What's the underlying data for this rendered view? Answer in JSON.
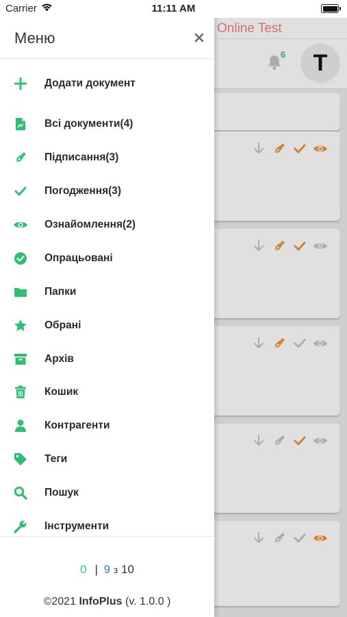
{
  "status_bar": {
    "carrier": "Carrier",
    "time": "11:11 AM"
  },
  "background": {
    "app_title": "Online Test",
    "notifications_count": "6",
    "avatar_letter": "T",
    "cards": [
      {
        "download": "grey",
        "sign": "orange",
        "approve": "orange",
        "view": "orange"
      },
      {
        "download": "grey",
        "sign": "orange",
        "approve": "orange",
        "view": "grey"
      },
      {
        "download": "grey",
        "sign": "orange",
        "approve": "grey",
        "view": "grey"
      },
      {
        "download": "grey",
        "sign": "grey",
        "approve": "orange",
        "view": "grey"
      },
      {
        "download": "grey",
        "sign": "grey",
        "approve": "grey",
        "view": "orange"
      }
    ]
  },
  "drawer": {
    "title": "Меню",
    "items": [
      {
        "label": "Додати документ",
        "icon": "plus-icon"
      },
      {
        "label": "Всі документи(4)",
        "icon": "document-icon"
      },
      {
        "label": "Підписання(3)",
        "icon": "pen-icon"
      },
      {
        "label": "Погодження(3)",
        "icon": "check-icon"
      },
      {
        "label": "Ознайомлення(2)",
        "icon": "eye-icon"
      },
      {
        "label": "Опрацьовані",
        "icon": "check-circle-icon"
      },
      {
        "label": "Папки",
        "icon": "folder-icon"
      },
      {
        "label": "Обрані",
        "icon": "star-icon"
      },
      {
        "label": "Архів",
        "icon": "archive-icon"
      },
      {
        "label": "Кошик",
        "icon": "trash-icon"
      },
      {
        "label": "Контрагенти",
        "icon": "user-icon"
      },
      {
        "label": "Теги",
        "icon": "tag-icon"
      },
      {
        "label": "Пошук",
        "icon": "search-icon"
      },
      {
        "label": "Інструменти",
        "icon": "wrench-icon"
      }
    ],
    "footer": {
      "pager_current": "0",
      "pager_separator": "|",
      "pager_page": "9",
      "pager_of": "з",
      "pager_total": "10",
      "copyright_prefix": "©2021",
      "copyright_brand": "InfoPlus",
      "copyright_version": "(v. 1.0.0 )"
    }
  },
  "colors": {
    "accent_green": "#2fbf71",
    "orange": "#f0953a",
    "grey_icon": "#c4c4c4",
    "title_red": "#f08080"
  }
}
